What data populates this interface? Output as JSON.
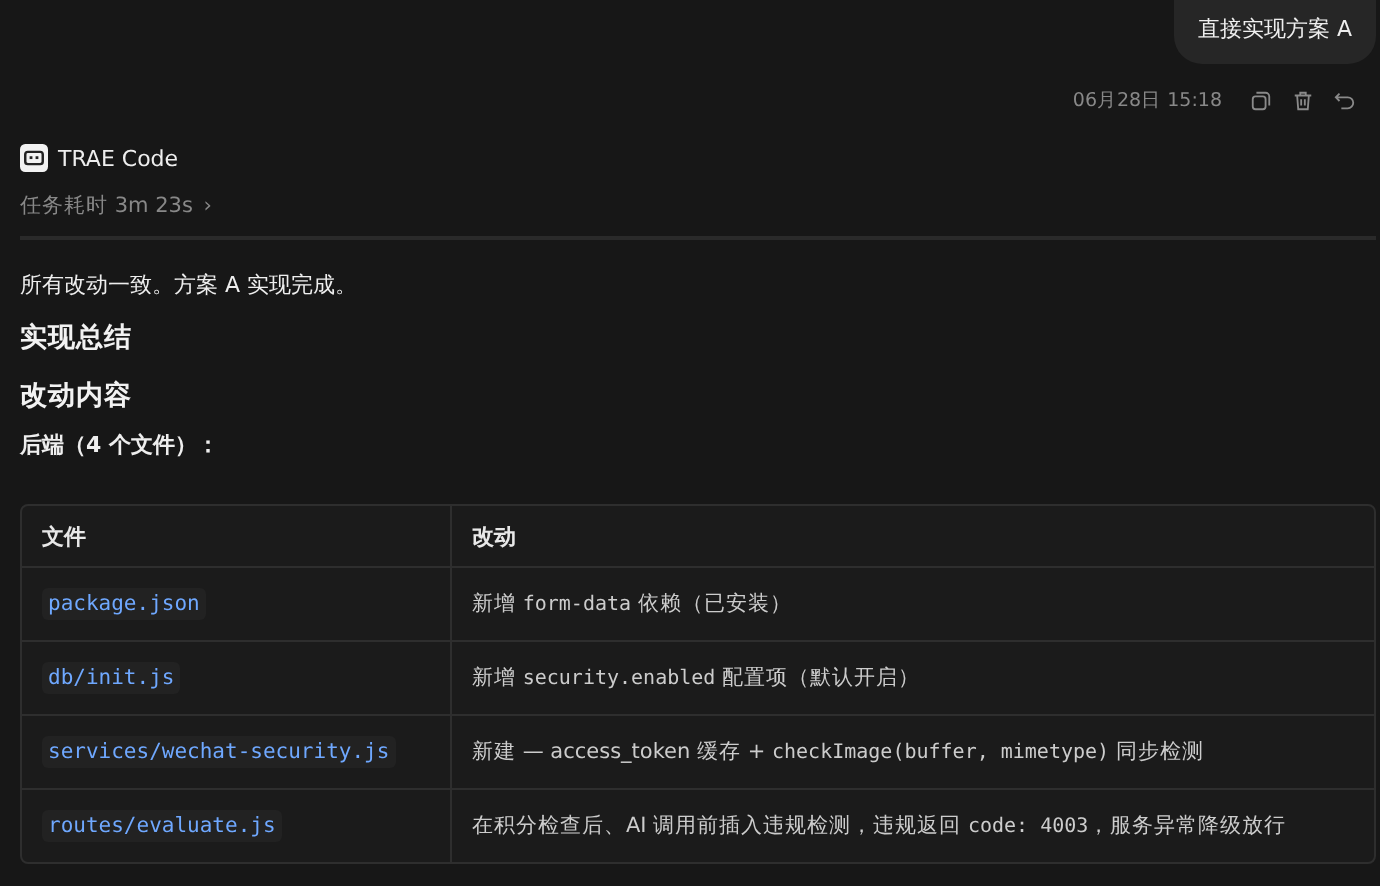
{
  "user_message": {
    "text": "直接实现方案 A"
  },
  "message_meta": {
    "timestamp": "06月28日 15:18"
  },
  "assistant": {
    "name": "TRAE Code",
    "duration": "任务耗时 3m 23s",
    "duration_chevron": "›"
  },
  "content": {
    "intro": "所有改动一致。方案 A 实现完成。",
    "heading_1": "实现总结",
    "heading_2": "改动内容",
    "subheading": "后端（4 个文件）："
  },
  "table": {
    "columns": [
      "文件",
      "改动"
    ],
    "rows": [
      {
        "file": "package.json",
        "change": [
          {
            "text": "新增 ",
            "code": false
          },
          {
            "text": "form-data",
            "code": true
          },
          {
            "text": " 依赖（已安装）",
            "code": false
          }
        ]
      },
      {
        "file": "db/init.js",
        "change": [
          {
            "text": "新增 ",
            "code": false
          },
          {
            "text": "security.enabled",
            "code": true
          },
          {
            "text": " 配置项（默认开启）",
            "code": false
          }
        ]
      },
      {
        "file": "services/wechat-security.js",
        "change": [
          {
            "text": "新建 — access_token 缓存 + ",
            "code": false
          },
          {
            "text": "checkImage(buffer, mimetype)",
            "code": true
          },
          {
            "text": " 同步检测",
            "code": false
          }
        ]
      },
      {
        "file": "routes/evaluate.js",
        "change": [
          {
            "text": "在积分检查后、AI 调用前插入违规检测，违规返回 ",
            "code": false
          },
          {
            "text": "code: 4003",
            "code": true
          },
          {
            "text": "，服务异常降级放行",
            "code": false
          }
        ]
      }
    ]
  }
}
